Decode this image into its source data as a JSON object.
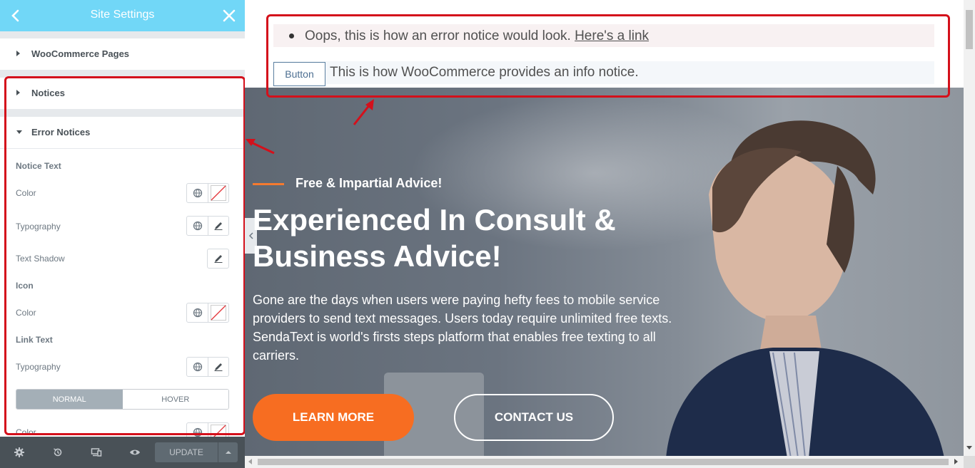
{
  "panel": {
    "title": "Site Settings",
    "sections": {
      "woocommerce_pages": "WooCommerce Pages",
      "notices": "Notices",
      "error_notices": "Error Notices"
    },
    "groups": {
      "notice_text": "Notice Text",
      "icon": "Icon",
      "link_text": "Link Text"
    },
    "controls": {
      "color": "Color",
      "typography": "Typography",
      "text_shadow": "Text Shadow"
    },
    "tabs": {
      "normal": "NORMAL",
      "hover": "HOVER"
    },
    "footer": {
      "update": "UPDATE"
    }
  },
  "preview": {
    "error_notice": {
      "text": "Oops, this is how an error notice would look.",
      "link": "Here's a link"
    },
    "info_notice": {
      "button": "Button",
      "text": "This is how WooCommerce provides an info notice."
    },
    "hero": {
      "eyebrow": "Free & Impartial Advice!",
      "headline": "Experienced In Consult & Business Advice!",
      "body": "Gone are the days when users were paying hefty fees to mobile service providers to send text messages. Users today require unlimited free texts. SendaText is world's firsts steps platform that enables free texting to all carriers.",
      "learn_more": "LEARN MORE",
      "contact_us": "CONTACT US"
    }
  },
  "colors": {
    "header": "#71d7f7",
    "accent_orange": "#f76d21",
    "annotation_red": "#d4101b",
    "panel_footer": "#495157"
  },
  "icons": [
    "back-arrow-icon",
    "close-icon",
    "caret-right-icon",
    "caret-down-icon",
    "globe-icon",
    "no-color-icon",
    "pencil-icon",
    "gear-icon",
    "history-icon",
    "responsive-icon",
    "eye-icon",
    "chevron-up-icon",
    "chevron-left-icon"
  ]
}
